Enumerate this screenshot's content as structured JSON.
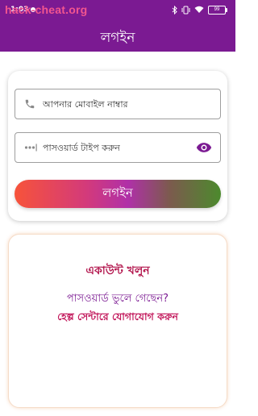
{
  "status_bar": {
    "time": "1:03",
    "battery": "99"
  },
  "watermark": "hack-cheat.org",
  "header": {
    "title": "লগইন"
  },
  "login_form": {
    "phone_placeholder": "আপনার মোবাইল নাম্বার",
    "password_placeholder": "পাসওয়ার্ড টাইপ করুন",
    "login_button": "লগইন"
  },
  "account_section": {
    "create_account": "একাউন্ট খলুন",
    "forgot_password": "পাসওয়ার্ড ভুলে গেছেন?",
    "help_center": "হেল্প সেন্টারে যোগাযোগ করুন"
  },
  "colors": {
    "header_bg": "#7b1a92",
    "create_account": "#b3174e",
    "forgot_password": "#7b1a92",
    "help_center": "#c2185b"
  },
  "icons": {
    "phone": "phone-icon",
    "password": "password-dots-icon",
    "eye": "eye-icon",
    "bluetooth": "bluetooth-icon",
    "vibrate": "vibrate-icon",
    "wifi": "wifi-icon",
    "battery": "battery-icon"
  }
}
